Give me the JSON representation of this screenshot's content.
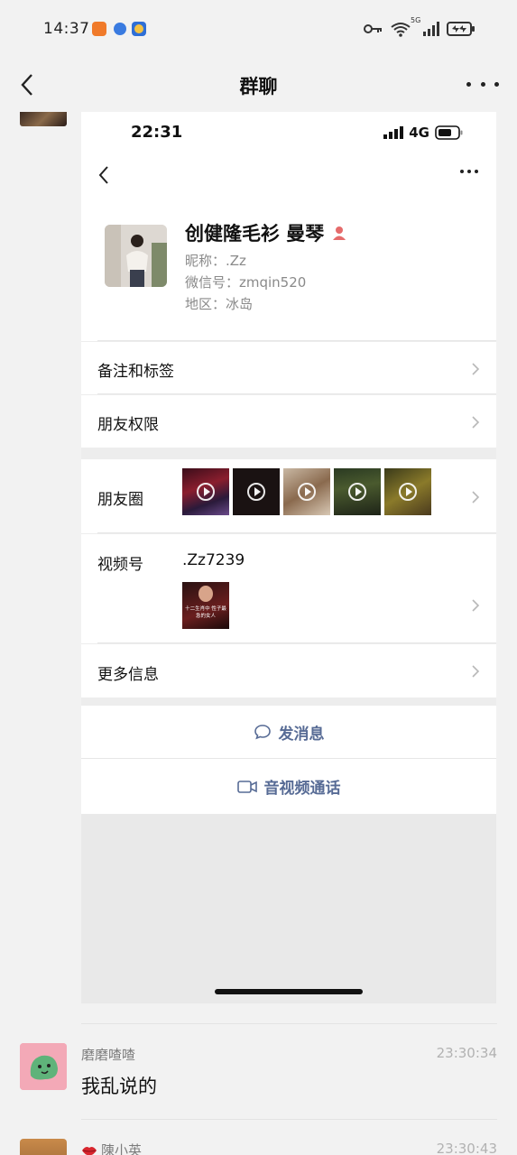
{
  "status_bar": {
    "time": "14:37",
    "network_badge": "5G",
    "icons": [
      "key-icon",
      "wifi-icon",
      "signal-icon",
      "battery-charging-icon"
    ]
  },
  "header": {
    "title": "群聊",
    "back_icon": "chevron-left-icon",
    "more_icon": "more-dots-icon"
  },
  "embedded_profile": {
    "status_time": "22:31",
    "network": "4G",
    "name": "创健隆毛衫 曼琴",
    "nickname": "昵称：.Zz",
    "wechat_id": "微信号：zmqin520",
    "region": "地区：冰岛",
    "rows": {
      "remark": "备注和标签",
      "permissions": "朋友权限",
      "moments": "朋友圈",
      "channels": "视频号",
      "channels_id": ".Zz7239",
      "channels_caption": "十二生肖中 性子最急的女人",
      "more_info": "更多信息"
    },
    "actions": {
      "message": "发消息",
      "call": "音视频通话"
    }
  },
  "messages": [
    {
      "sender": "磨磨喳喳",
      "time": "23:30:34",
      "text": "我乱说的"
    },
    {
      "sender": "陳小英",
      "time": "23:30:43",
      "text": ""
    }
  ],
  "colors": {
    "link_blue": "#576b95",
    "background": "#f2f2f2",
    "badge_red": "#e56b6b"
  }
}
